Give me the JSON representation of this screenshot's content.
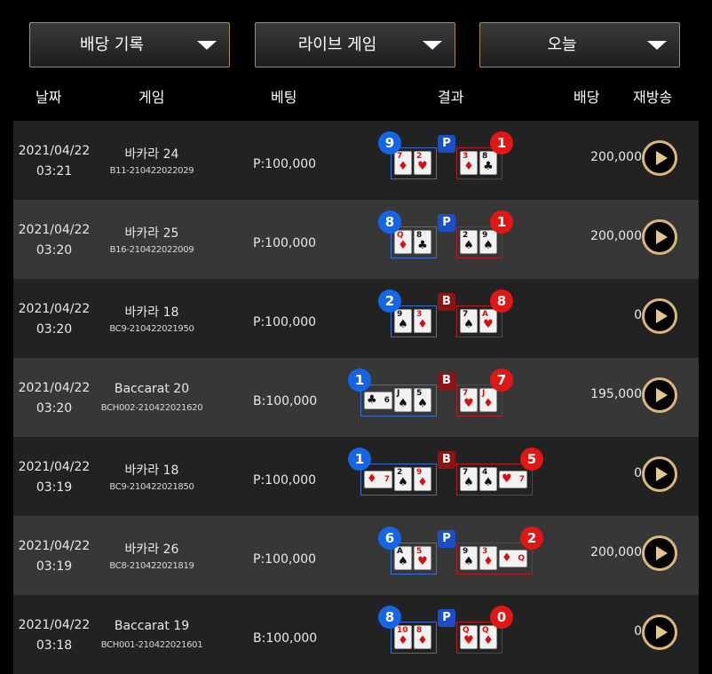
{
  "filters": [
    {
      "label": "배당 기록"
    },
    {
      "label": "라이브 게임"
    },
    {
      "label": "오늘"
    }
  ],
  "columns": {
    "date": "날짜",
    "game": "게임",
    "bet": "베팅",
    "result": "결과",
    "payout": "배당",
    "replay": "재방송"
  },
  "colors": {
    "player": "#1466e6",
    "banker": "#e31616",
    "accent": "#d9b97a"
  },
  "rows": [
    {
      "date": "2021/04/22",
      "time": "03:21",
      "game": "바카라 24",
      "code": "B11-210422022029",
      "bet": "P:100,000",
      "payout": "200,000",
      "result": {
        "player_score": "9",
        "banker_score": "1",
        "winner": "P",
        "player_cards": [
          {
            "rank": "7",
            "suit": "♦",
            "color": "red"
          },
          {
            "rank": "2",
            "suit": "♥",
            "color": "red"
          }
        ],
        "banker_cards": [
          {
            "rank": "3",
            "suit": "♦",
            "color": "red"
          },
          {
            "rank": "8",
            "suit": "♣",
            "color": "black"
          }
        ]
      }
    },
    {
      "date": "2021/04/22",
      "time": "03:20",
      "game": "바카라 25",
      "code": "B16-210422022009",
      "bet": "P:100,000",
      "payout": "200,000",
      "result": {
        "player_score": "8",
        "banker_score": "1",
        "winner": "P",
        "player_cards": [
          {
            "rank": "Q",
            "suit": "♦",
            "color": "red"
          },
          {
            "rank": "8",
            "suit": "♣",
            "color": "black"
          }
        ],
        "banker_cards": [
          {
            "rank": "2",
            "suit": "♠",
            "color": "black"
          },
          {
            "rank": "9",
            "suit": "♠",
            "color": "black"
          }
        ]
      }
    },
    {
      "date": "2021/04/22",
      "time": "03:20",
      "game": "바카라 18",
      "code": "BC9-210422021950",
      "bet": "P:100,000",
      "payout": "0",
      "result": {
        "player_score": "2",
        "banker_score": "8",
        "winner": "B",
        "player_cards": [
          {
            "rank": "9",
            "suit": "♠",
            "color": "black"
          },
          {
            "rank": "3",
            "suit": "♦",
            "color": "red"
          }
        ],
        "banker_cards": [
          {
            "rank": "7",
            "suit": "♠",
            "color": "black"
          },
          {
            "rank": "A",
            "suit": "♥",
            "color": "red"
          }
        ]
      }
    },
    {
      "date": "2021/04/22",
      "time": "03:20",
      "game": "Baccarat 20",
      "code": "BCH002-210422021620",
      "bet": "B:100,000",
      "payout": "195,000",
      "result": {
        "player_score": "1",
        "banker_score": "7",
        "winner": "B",
        "player_side": {
          "rank": "6",
          "suit": "♣",
          "color": "black"
        },
        "player_cards": [
          {
            "rank": "J",
            "suit": "♠",
            "color": "black"
          },
          {
            "rank": "5",
            "suit": "♠",
            "color": "black"
          }
        ],
        "banker_cards": [
          {
            "rank": "7",
            "suit": "♥",
            "color": "red"
          },
          {
            "rank": "J",
            "suit": "♦",
            "color": "red"
          }
        ]
      }
    },
    {
      "date": "2021/04/22",
      "time": "03:19",
      "game": "바카라 18",
      "code": "BC9-210422021850",
      "bet": "P:100,000",
      "payout": "0",
      "result": {
        "player_score": "1",
        "banker_score": "5",
        "winner": "B",
        "player_side": {
          "rank": "7",
          "suit": "♦",
          "color": "red"
        },
        "player_cards": [
          {
            "rank": "2",
            "suit": "♠",
            "color": "black"
          },
          {
            "rank": "9",
            "suit": "♦",
            "color": "red"
          }
        ],
        "banker_cards": [
          {
            "rank": "7",
            "suit": "♠",
            "color": "black"
          },
          {
            "rank": "4",
            "suit": "♠",
            "color": "black"
          }
        ],
        "banker_side": {
          "rank": "7",
          "suit": "♥",
          "color": "red"
        }
      }
    },
    {
      "date": "2021/04/22",
      "time": "03:19",
      "game": "바카라 26",
      "code": "BC8-210422021819",
      "bet": "P:100,000",
      "payout": "200,000",
      "result": {
        "player_score": "6",
        "banker_score": "2",
        "winner": "P",
        "player_cards": [
          {
            "rank": "A",
            "suit": "♠",
            "color": "black"
          },
          {
            "rank": "5",
            "suit": "♥",
            "color": "red"
          }
        ],
        "banker_cards": [
          {
            "rank": "9",
            "suit": "♠",
            "color": "black"
          },
          {
            "rank": "3",
            "suit": "♦",
            "color": "red"
          }
        ],
        "banker_side": {
          "rank": "Q",
          "suit": "♦",
          "color": "red"
        }
      }
    },
    {
      "date": "2021/04/22",
      "time": "03:18",
      "game": "Baccarat 19",
      "code": "BCH001-210422021601",
      "bet": "B:100,000",
      "payout": "0",
      "result": {
        "player_score": "8",
        "banker_score": "0",
        "winner": "P",
        "player_cards": [
          {
            "rank": "10",
            "suit": "♦",
            "color": "red"
          },
          {
            "rank": "8",
            "suit": "♦",
            "color": "red"
          }
        ],
        "banker_cards": [
          {
            "rank": "Q",
            "suit": "♥",
            "color": "red"
          },
          {
            "rank": "Q",
            "suit": "♦",
            "color": "red"
          }
        ]
      }
    }
  ]
}
